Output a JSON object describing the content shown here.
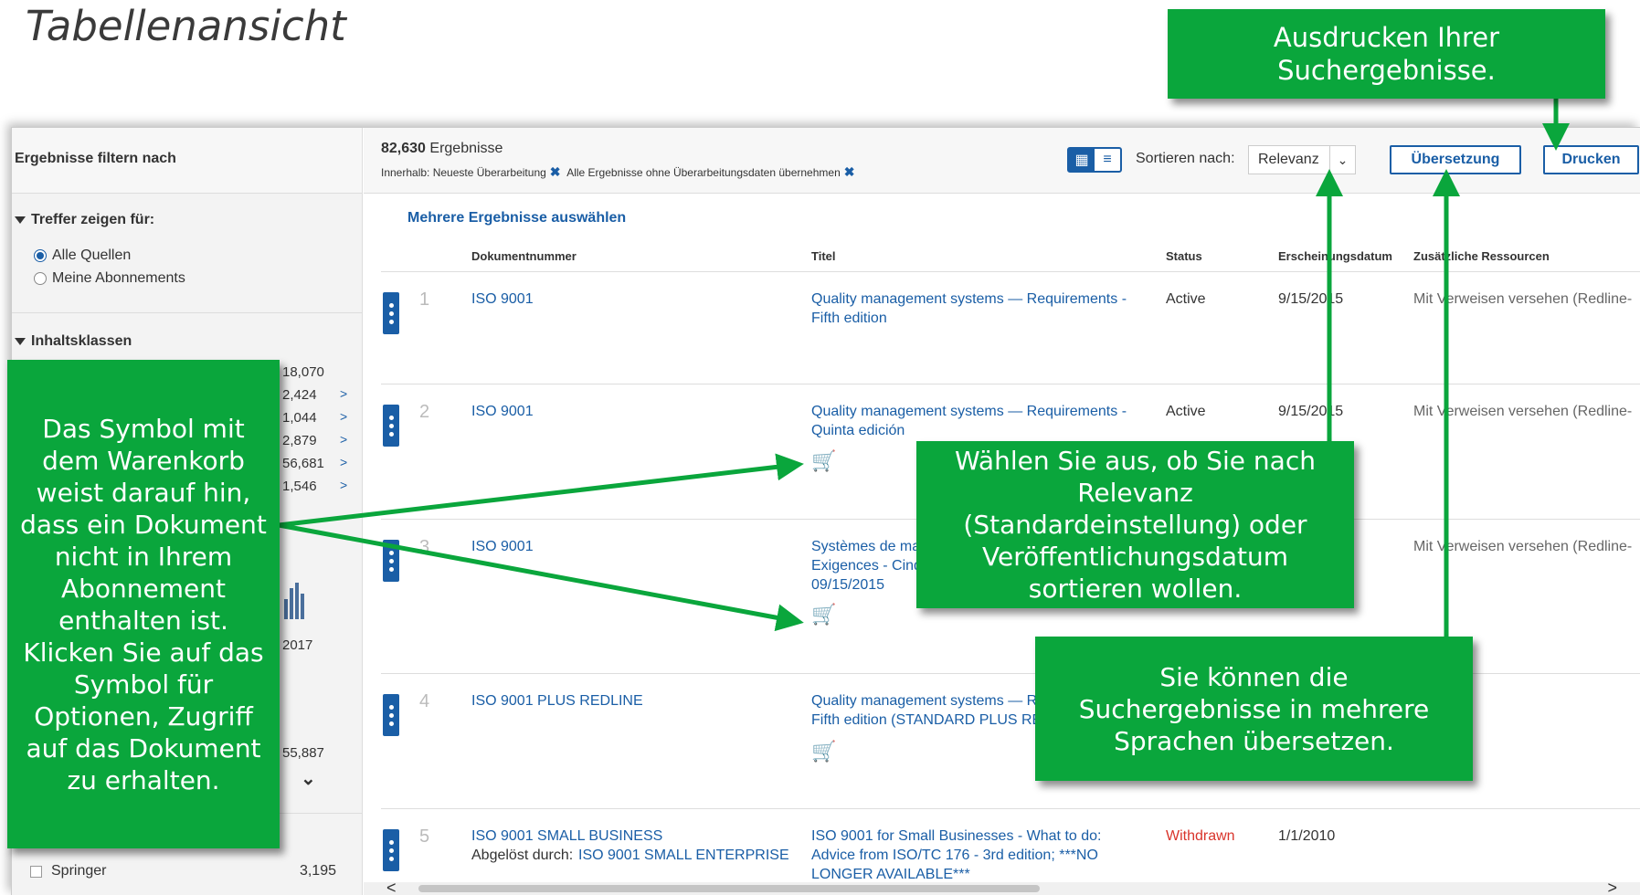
{
  "slide": {
    "title": "Tabellenansicht"
  },
  "sidebar": {
    "heading": "Ergebnisse filtern nach",
    "section_hits": "Treffer zeigen für:",
    "radio_all": "Alle Quellen",
    "radio_subs": "Meine Abonnements",
    "section_classes": "Inhaltsklassen",
    "counts": [
      "18,070",
      "2,424",
      "1,044",
      "2,879",
      "56,681",
      "1,546"
    ],
    "year_label": "2017",
    "total_partial": "55,887",
    "publisher": "Springer",
    "publisher_count": "3,195"
  },
  "topbar": {
    "results_count": "82,630",
    "results_word": "Ergebnisse",
    "filter_within": "Innerhalb: Neueste Überarbeitung",
    "filter_all": "Alle Ergebnisse ohne Überarbeitungsdaten übernehmen",
    "sort_label": "Sortieren nach:",
    "sort_value": "Relevanz",
    "translate_button": "Übersetzung",
    "print_button": "Drucken"
  },
  "table": {
    "multi_select": "Mehrere Ergebnisse auswählen",
    "columns": [
      "Dokumentnummer",
      "Titel",
      "Status",
      "Erscheinungsdatum",
      "Zusätzliche Ressourcen"
    ],
    "rows": [
      {
        "num": "1",
        "doc": "ISO 9001",
        "title1": "Quality management systems — Requirements -",
        "title2": "Fifth edition",
        "status": "Active",
        "date": "9/15/2015",
        "extra": "Mit Verweisen versehen (Redline-"
      },
      {
        "num": "2",
        "doc": "ISO 9001",
        "title1": "Quality management systems — Requirements -",
        "title2": "Quinta edición",
        "status": "Active",
        "date": "9/15/2015",
        "extra": "Mit Verweisen versehen (Redline-"
      },
      {
        "num": "3",
        "doc": "ISO 9001",
        "title1": "Systèmes de ma",
        "title2": "Exigences - Cinq",
        "title3": "09/15/2015",
        "extra": "Mit Verweisen versehen (Redline-"
      },
      {
        "num": "4",
        "doc": "ISO 9001 PLUS REDLINE",
        "title1": "Quality management systems — R",
        "title2": "Fifth edition (STANDARD PLUS RE"
      },
      {
        "num": "5",
        "doc": "ISO 9001 SMALL BUSINESS",
        "superseded_label": "Abgelöst durch:",
        "superseded_link": "ISO 9001 SMALL ENTERPRISE",
        "title1": "ISO 9001 for Small Businesses - What to do:",
        "title2": "Advice from ISO/TC 176 - 3rd edition; ***NO",
        "title3": "LONGER AVAILABLE***",
        "status": "Withdrawn",
        "date": "1/1/2010"
      }
    ]
  },
  "callouts": {
    "print": "Ausdrucken Ihrer Suchergebnisse.",
    "cart": "Das Symbol mit dem Warenkorb weist darauf hin, dass ein Dokument nicht in Ihrem Abonnement enthalten ist. Klicken Sie auf das Symbol für Optionen, Zugriff auf das Dokument zu erhalten.",
    "sort": "Wählen Sie aus, ob Sie nach Relevanz (Standardeinstellung) oder Veröffentlichungsdatum sortieren wollen.",
    "translate": "Sie können die Suchergebnisse in mehrere Sprachen übersetzen."
  },
  "colors": {
    "brand_blue": "#1a5ea6",
    "callout_green": "#0aa63c",
    "withdrawn_red": "#d9342b"
  }
}
